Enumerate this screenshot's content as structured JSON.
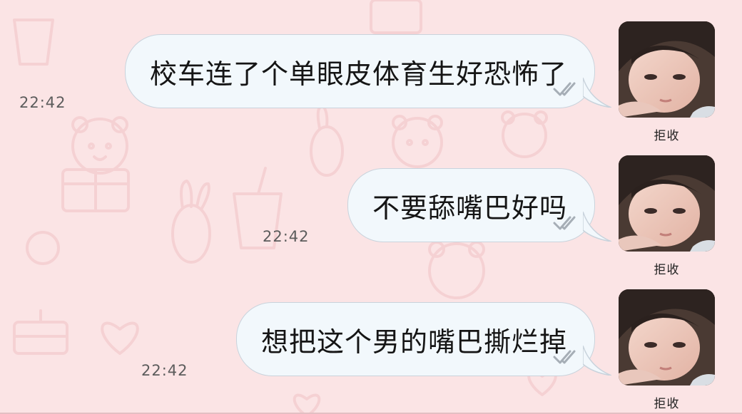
{
  "theme": {
    "background": "#fbe4e5",
    "pattern": "#f3c8cb",
    "bubble_fill": "#f2f8fc",
    "bubble_border": "#c9d3dc",
    "read_check": "#a6aeb6"
  },
  "background_icons": [
    "bear-face-icon",
    "bunny-icon",
    "heart-icon",
    "cake-icon",
    "drink-cup-icon",
    "sun-icon",
    "gift-box-icon"
  ],
  "messages": [
    {
      "text": "校车连了个单眼皮体育生好恐怖了",
      "time": "22:42",
      "sender_label": "拒收",
      "status_icon": "double-check-icon"
    },
    {
      "text": "不要舔嘴巴好吗",
      "time": "22:42",
      "sender_label": "拒收",
      "status_icon": "double-check-icon"
    },
    {
      "text": "想把这个男的嘴巴撕烂掉",
      "time": "22:42",
      "sender_label": "拒收",
      "status_icon": "double-check-icon"
    }
  ]
}
